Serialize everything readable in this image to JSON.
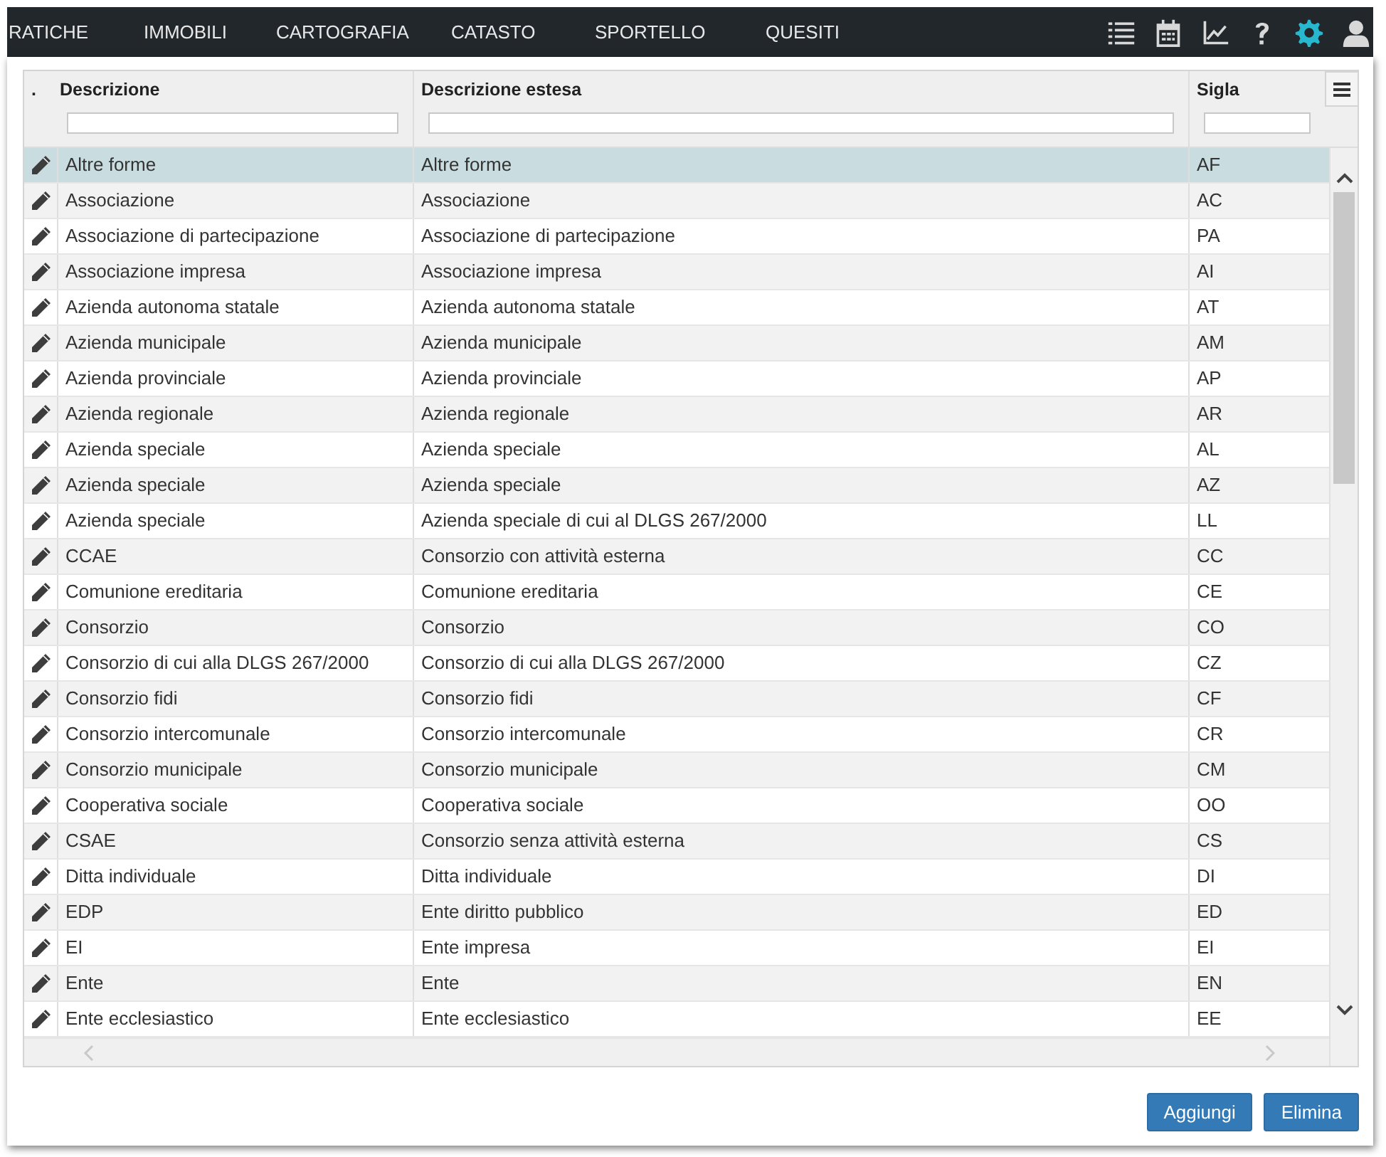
{
  "nav": {
    "items": [
      {
        "label": "RATICHE",
        "selected": false
      },
      {
        "label": "IMMOBILI",
        "selected": false
      },
      {
        "label": "CARTOGRAFIA",
        "selected": false
      },
      {
        "label": "CATASTO",
        "selected": false
      },
      {
        "label": "SPORTELLO",
        "selected": false
      },
      {
        "label": "QUESITI",
        "selected": false
      }
    ],
    "icons": [
      {
        "kind": "list",
        "active": false
      },
      {
        "kind": "calendar",
        "active": false
      },
      {
        "kind": "chart",
        "active": false
      },
      {
        "kind": "help",
        "active": false
      },
      {
        "kind": "settings",
        "active": true
      },
      {
        "kind": "user",
        "active": false
      }
    ]
  },
  "table": {
    "columns": [
      {
        "label": "."
      },
      {
        "label": "Descrizione"
      },
      {
        "label": "Descrizione estesa"
      },
      {
        "label": "Sigla"
      }
    ],
    "rows": [
      {
        "descrizione": "Altre forme",
        "estesa": "Altre forme",
        "sigla": "AF",
        "selected": true
      },
      {
        "descrizione": "Associazione",
        "estesa": "Associazione",
        "sigla": "AC",
        "selected": false
      },
      {
        "descrizione": "Associazione di partecipazione",
        "estesa": "Associazione di partecipazione",
        "sigla": "PA",
        "selected": false
      },
      {
        "descrizione": "Associazione impresa",
        "estesa": "Associazione impresa",
        "sigla": "AI",
        "selected": false
      },
      {
        "descrizione": "Azienda autonoma statale",
        "estesa": "Azienda autonoma statale",
        "sigla": "AT",
        "selected": false
      },
      {
        "descrizione": "Azienda municipale",
        "estesa": "Azienda municipale",
        "sigla": "AM",
        "selected": false
      },
      {
        "descrizione": "Azienda provinciale",
        "estesa": "Azienda provinciale",
        "sigla": "AP",
        "selected": false
      },
      {
        "descrizione": "Azienda regionale",
        "estesa": "Azienda regionale",
        "sigla": "AR",
        "selected": false
      },
      {
        "descrizione": "Azienda speciale",
        "estesa": "Azienda speciale",
        "sigla": "AL",
        "selected": false
      },
      {
        "descrizione": "Azienda speciale",
        "estesa": "Azienda speciale",
        "sigla": "AZ",
        "selected": false
      },
      {
        "descrizione": "Azienda speciale",
        "estesa": "Azienda speciale di cui al DLGS 267/2000",
        "sigla": "LL",
        "selected": false
      },
      {
        "descrizione": "CCAE",
        "estesa": "Consorzio con attività esterna",
        "sigla": "CC",
        "selected": false
      },
      {
        "descrizione": "Comunione ereditaria",
        "estesa": "Comunione ereditaria",
        "sigla": "CE",
        "selected": false
      },
      {
        "descrizione": "Consorzio",
        "estesa": "Consorzio",
        "sigla": "CO",
        "selected": false
      },
      {
        "descrizione": "Consorzio di cui alla DLGS 267/2000",
        "estesa": "Consorzio di cui alla DLGS 267/2000",
        "sigla": "CZ",
        "selected": false
      },
      {
        "descrizione": "Consorzio fidi",
        "estesa": "Consorzio fidi",
        "sigla": "CF",
        "selected": false
      },
      {
        "descrizione": "Consorzio intercomunale",
        "estesa": "Consorzio intercomunale",
        "sigla": "CR",
        "selected": false
      },
      {
        "descrizione": "Consorzio municipale",
        "estesa": "Consorzio municipale",
        "sigla": "CM",
        "selected": false
      },
      {
        "descrizione": "Cooperativa sociale",
        "estesa": "Cooperativa sociale",
        "sigla": "OO",
        "selected": false
      },
      {
        "descrizione": "CSAE",
        "estesa": "Consorzio senza attività esterna",
        "sigla": "CS",
        "selected": false
      },
      {
        "descrizione": "Ditta individuale",
        "estesa": "Ditta individuale",
        "sigla": "DI",
        "selected": false
      },
      {
        "descrizione": "EDP",
        "estesa": "Ente diritto pubblico",
        "sigla": "ED",
        "selected": false
      },
      {
        "descrizione": "EI",
        "estesa": "Ente impresa",
        "sigla": "EI",
        "selected": false
      },
      {
        "descrizione": "Ente",
        "estesa": "Ente",
        "sigla": "EN",
        "selected": false
      },
      {
        "descrizione": "Ente ecclesiastico",
        "estesa": "Ente ecclesiastico",
        "sigla": "EE",
        "selected": false
      }
    ]
  },
  "buttons": [
    {
      "label": "Aggiungi"
    },
    {
      "label": "Elimina"
    }
  ]
}
